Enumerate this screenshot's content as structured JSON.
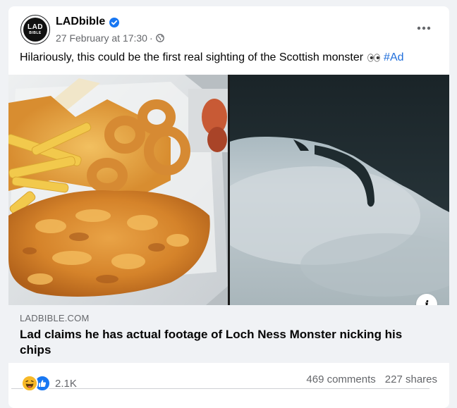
{
  "post": {
    "page_name": "LADbible",
    "date": "27 February at 17:30",
    "separator": "·",
    "text": "Hilariously, this could be the first real sighting of the Scottish monster",
    "hashtag": "#Ad",
    "avatar_logo_top": "LAD",
    "avatar_logo_bottom": "BIBLE"
  },
  "link": {
    "domain": "LADBIBLE.COM",
    "title": "Lad claims he has actual footage of Loch Ness Monster nicking his chips",
    "info_label": "i"
  },
  "footer": {
    "reaction_count": "2.1K",
    "comments": "469 comments",
    "shares": "227 shares"
  },
  "icons": {
    "verified": "verified-badge-icon",
    "audience": "globe-icon",
    "more": "more-options-icon",
    "eyes": "eyes-emoji-icon",
    "reaction_haha": "haha-reaction-icon",
    "reaction_like": "like-reaction-icon"
  },
  "colors": {
    "accent": "#1877f2",
    "hashtag": "#216fdb",
    "secondary_text": "#65676b",
    "link_box": "#f0f2f5"
  }
}
